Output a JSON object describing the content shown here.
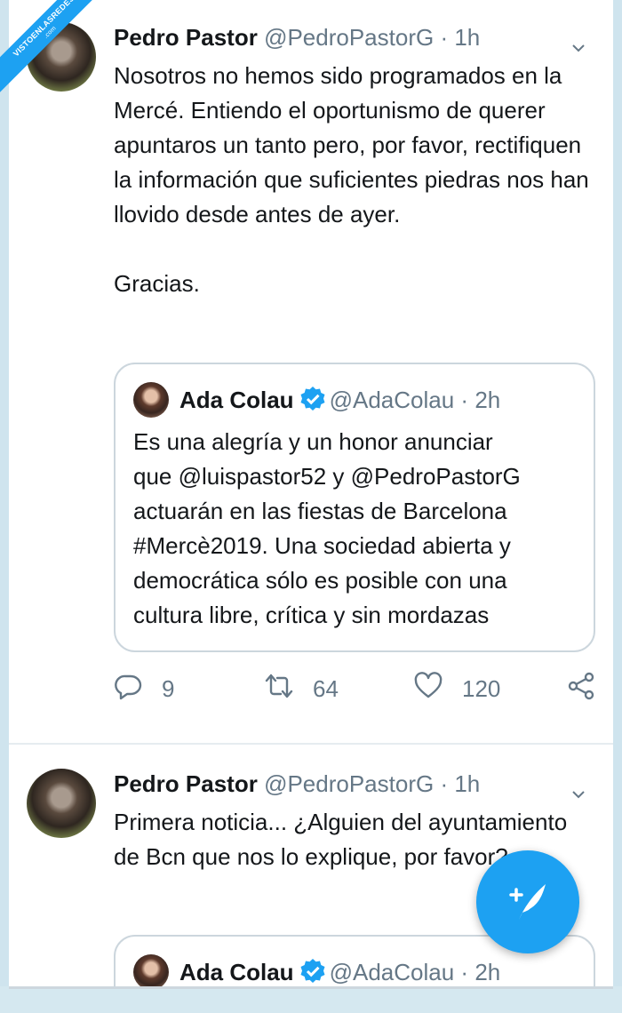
{
  "watermark": {
    "text": "VISTOENLASREDES",
    "sub": ".com"
  },
  "tweets": [
    {
      "author": {
        "name": "Pedro Pastor",
        "handle": "@PedroPastorG",
        "time": "1h"
      },
      "paragraphs": [
        "Nosotros no hemos sido programados en la Mercé. Entiendo el oportunismo de querer apuntaros un tanto pero, por favor, rectifiquen la información que suficientes piedras nos han llovido desde antes de ayer.",
        "Gracias."
      ],
      "quote": {
        "author": {
          "name": "Ada Colau",
          "handle": "@AdaColau",
          "time": "2h"
        },
        "lines": [
          "Es una alegría y un honor anunciar",
          "que @luispastor52  y @PedroPastorG",
          "actuarán en las fiestas de Barcelona",
          "#Mercè2019. Una sociedad abierta y",
          "democrática sólo es posible con una",
          "cultura libre, crítica y sin mordazas"
        ]
      },
      "actions": {
        "replies": "9",
        "retweets": "64",
        "likes": "120"
      }
    },
    {
      "author": {
        "name": "Pedro Pastor",
        "handle": "@PedroPastorG",
        "time": "1h"
      },
      "paragraphs": [
        "Primera noticia... ¿Alguien del ayuntamiento de Bcn que nos lo explique, por favor?"
      ],
      "quote": {
        "author": {
          "name": "Ada Colau",
          "handle": "@AdaColau",
          "time": "2h"
        }
      }
    }
  ],
  "separator": "·",
  "icons": {
    "reply": "reply-icon",
    "retweet": "retweet-icon",
    "like": "heart-icon",
    "share": "share-icon",
    "menu": "chevron-down-icon",
    "verified": "verified-badge-icon",
    "compose": "compose-tweet-icon"
  },
  "colors": {
    "accent": "#1da1f2",
    "secondary_text": "#657786",
    "border": "#ccd6dd"
  }
}
